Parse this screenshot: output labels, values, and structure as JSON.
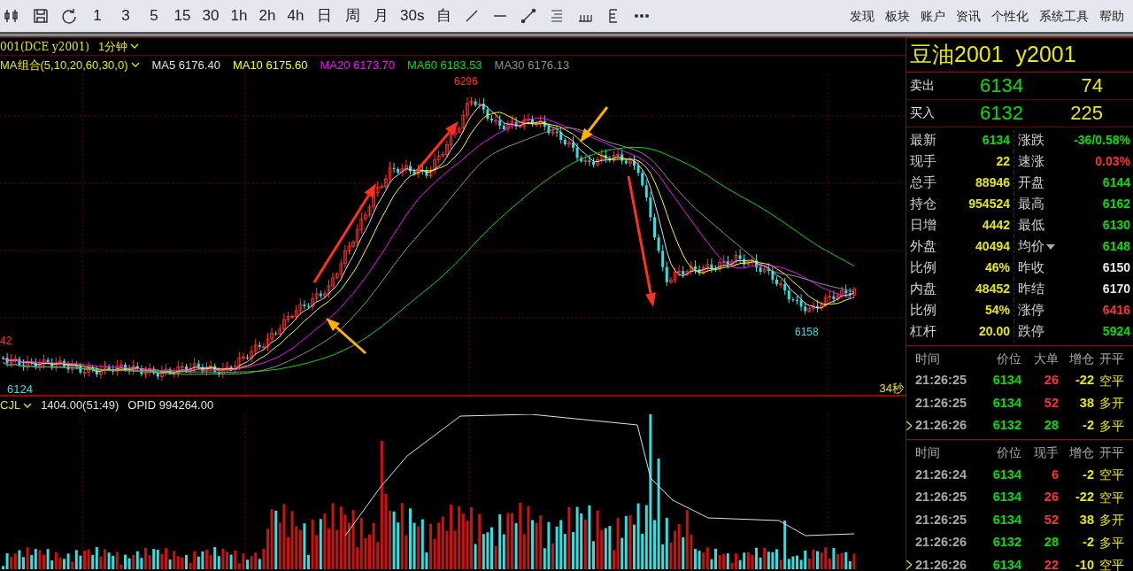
{
  "toolbar": {
    "periods": [
      "1",
      "3",
      "5",
      "15",
      "30",
      "1h",
      "2h",
      "4h",
      "日",
      "周",
      "月",
      "30s",
      "自"
    ]
  },
  "menu": [
    "发现",
    "板块",
    "账户",
    "资讯",
    "个性化",
    "系统工具",
    "帮助"
  ],
  "chart": {
    "instrument": "001(DCE y2001)",
    "period": "1分钟",
    "ma_group": "MA组合(5,10,20,60,30,0)",
    "mas": [
      {
        "label": "MA5 6176.40",
        "color": "#e0e0e0"
      },
      {
        "label": "MA10 6175.60",
        "color": "#ffff00"
      },
      {
        "label": "MA20 6173.70",
        "color": "#ff00ff"
      },
      {
        "label": "MA60 6183.53",
        "color": "#00e000"
      },
      {
        "label": "MA30 6176.13",
        "color": "#909090"
      }
    ],
    "high_label": "6296",
    "low_label": "6158",
    "left_low_label": "6124",
    "left_cut_label": "42",
    "countdown": "34秒"
  },
  "volume": {
    "indicator": "CJL",
    "reading": "1404.00(51:49)",
    "opid": "OPID 994264.00"
  },
  "quote": {
    "title": "豆油2001  y2001",
    "book": [
      {
        "label": "卖出",
        "price": "6134",
        "volume": "74"
      },
      {
        "label": "买入",
        "price": "6132",
        "volume": "225"
      }
    ],
    "stats": [
      {
        "left": {
          "label": "最新",
          "value": "6134",
          "color": "#00e000",
          "dropdown": false
        },
        "right": {
          "label": "涨跌",
          "value": "-36/0.58%",
          "color": "#00e000",
          "dropdown": false
        }
      },
      {
        "left": {
          "label": "现手",
          "value": "22",
          "color": "#e8e800",
          "dropdown": false
        },
        "right": {
          "label": "速涨",
          "value": "0.03%",
          "color": "#ff3030",
          "dropdown": false
        }
      },
      {
        "left": {
          "label": "总手",
          "value": "88946",
          "color": "#e8e800",
          "dropdown": false
        },
        "right": {
          "label": "开盘",
          "value": "6144",
          "color": "#00e000",
          "dropdown": false
        }
      },
      {
        "left": {
          "label": "持仓",
          "value": "954524",
          "color": "#e8e800",
          "dropdown": false
        },
        "right": {
          "label": "最高",
          "value": "6162",
          "color": "#00e000",
          "dropdown": false
        }
      },
      {
        "left": {
          "label": "日增",
          "value": "4442",
          "color": "#e8e800",
          "dropdown": false
        },
        "right": {
          "label": "最低",
          "value": "6130",
          "color": "#00e000",
          "dropdown": false
        }
      },
      {
        "left": {
          "label": "外盘",
          "value": "40494",
          "color": "#e8e800",
          "dropdown": false
        },
        "right": {
          "label": "均价",
          "value": "6148",
          "color": "#00e000",
          "dropdown": true
        }
      },
      {
        "left": {
          "label": "比例",
          "value": "46%",
          "color": "#e8e800",
          "dropdown": false
        },
        "right": {
          "label": "昨收",
          "value": "6150",
          "color": "#e8e8e8",
          "dropdown": false
        }
      },
      {
        "left": {
          "label": "内盘",
          "value": "48452",
          "color": "#e8e800",
          "dropdown": false
        },
        "right": {
          "label": "昨结",
          "value": "6170",
          "color": "#e8e8e8",
          "dropdown": false
        }
      },
      {
        "left": {
          "label": "比例",
          "value": "54%",
          "color": "#e8e800",
          "dropdown": false
        },
        "right": {
          "label": "涨停",
          "value": "6416",
          "color": "#ff3030",
          "dropdown": false
        }
      },
      {
        "left": {
          "label": "杠杆",
          "value": "20.00",
          "color": "#e8e800",
          "dropdown": false
        },
        "right": {
          "label": "跌停",
          "value": "5924",
          "color": "#00e000",
          "dropdown": false
        }
      }
    ]
  },
  "trade_tables": [
    {
      "columns": [
        "时间",
        "价位",
        "大单",
        "增仓",
        "开平"
      ],
      "rows": [
        {
          "time": "21:26:25",
          "price": "6134",
          "size": "26",
          "color": "#ff3030",
          "oi": "-22",
          "type": "空平",
          "current": false
        },
        {
          "time": "21:26:25",
          "price": "6134",
          "size": "52",
          "color": "#ff3030",
          "oi": "38",
          "type": "多开",
          "current": false
        },
        {
          "time": "21:26:26",
          "price": "6132",
          "size": "28",
          "color": "#00e000",
          "oi": "-2",
          "type": "多平",
          "current": true
        }
      ]
    },
    {
      "columns": [
        "时间",
        "价位",
        "现手",
        "增仓",
        "开平"
      ],
      "rows": [
        {
          "time": "21:26:24",
          "price": "6134",
          "size": "6",
          "color": "#ff3030",
          "oi": "-2",
          "type": "空平",
          "current": false
        },
        {
          "time": "21:26:25",
          "price": "6134",
          "size": "26",
          "color": "#ff3030",
          "oi": "-22",
          "type": "空平",
          "current": false
        },
        {
          "time": "21:26:25",
          "price": "6134",
          "size": "52",
          "color": "#ff3030",
          "oi": "38",
          "type": "多开",
          "current": false
        },
        {
          "time": "21:26:26",
          "price": "6132",
          "size": "28",
          "color": "#00e000",
          "oi": "-2",
          "type": "多平",
          "current": false
        },
        {
          "time": "21:26:26",
          "price": "6134",
          "size": "22",
          "color": "#ff3030",
          "oi": "-10",
          "type": "空平",
          "current": true
        }
      ]
    }
  ]
}
